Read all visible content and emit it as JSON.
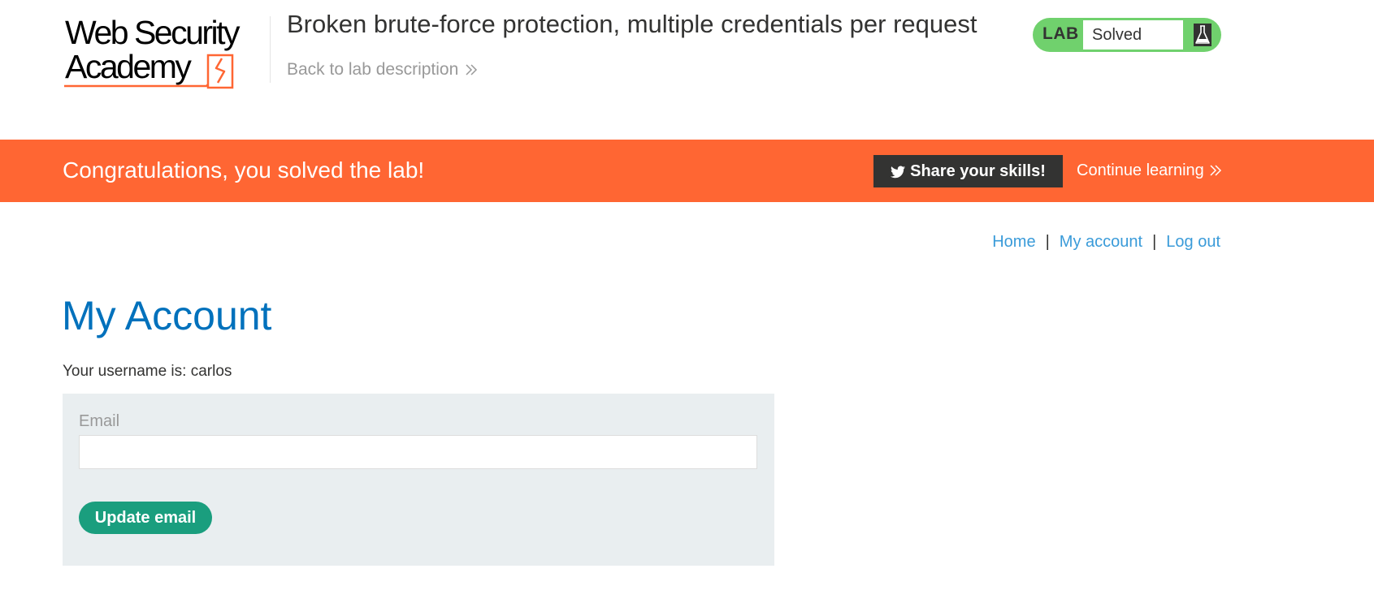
{
  "header": {
    "logo": {
      "line1": "Web Security",
      "line2": "Academy"
    },
    "lab_title": "Broken brute-force protection, multiple credentials per request",
    "back_link": "Back to lab description"
  },
  "lab_status": {
    "label": "LAB",
    "state": "Solved",
    "icon": "flask-icon"
  },
  "banner": {
    "message": "Congratulations, you solved the lab!",
    "share_button": "Share your skills!",
    "share_icon": "twitter-icon",
    "continue_link": "Continue learning"
  },
  "nav": {
    "items": [
      {
        "label": "Home"
      },
      {
        "label": "My account"
      },
      {
        "label": "Log out"
      }
    ],
    "separator": "|"
  },
  "main": {
    "title": "My Account",
    "username_line": "Your username is: carlos",
    "email_form": {
      "label": "Email",
      "value": "",
      "button": "Update email"
    }
  },
  "colors": {
    "accent_orange": "#ff6633",
    "title_blue": "#0071bc",
    "link_blue": "#3a9bd9",
    "solved_green": "#70d16d",
    "button_green": "#1a9e7e",
    "panel_gray": "#e9eef0",
    "dark": "#333332"
  }
}
